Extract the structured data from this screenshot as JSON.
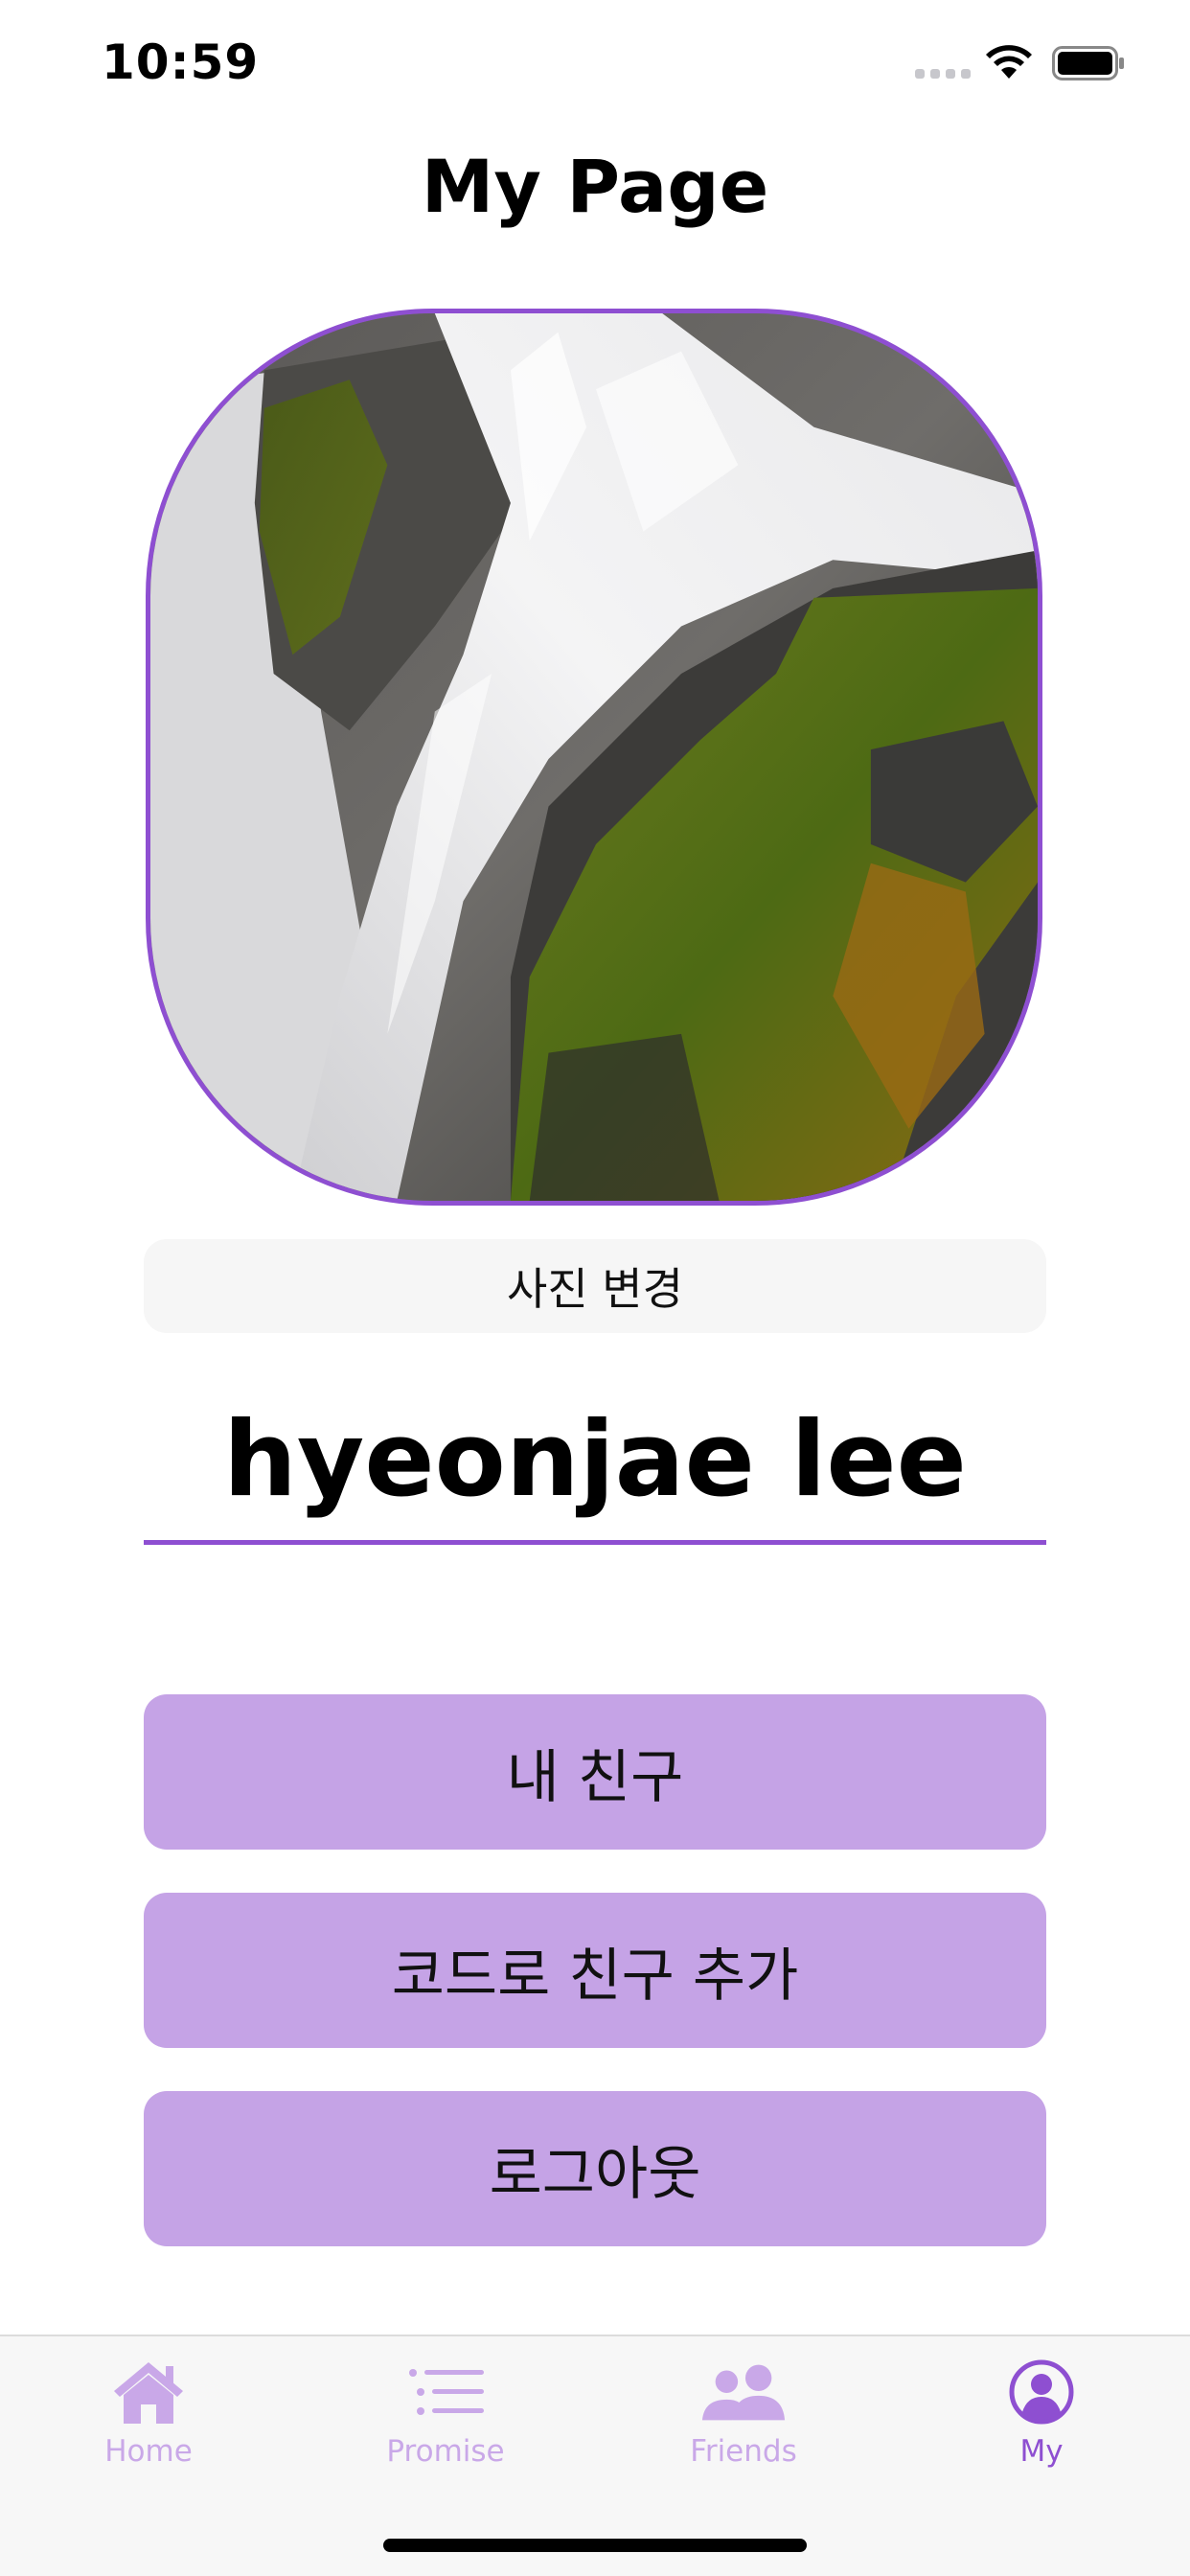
{
  "status_bar": {
    "time": "10:59"
  },
  "header": {
    "title": "My Page"
  },
  "profile": {
    "photo_alt": "waterfall-photo",
    "change_photo_label": "사진 변경",
    "name": "hyeonjae lee"
  },
  "actions": {
    "my_friends_label": "내 친구",
    "add_friend_by_code_label": "코드로 친구 추가",
    "logout_label": "로그아웃"
  },
  "tab_bar": {
    "items": [
      {
        "label": "Home",
        "icon": "house-icon",
        "active": false
      },
      {
        "label": "Promise",
        "icon": "list-icon",
        "active": false
      },
      {
        "label": "Friends",
        "icon": "people-icon",
        "active": false
      },
      {
        "label": "My",
        "icon": "person-circle-icon",
        "active": true
      }
    ]
  },
  "colors": {
    "accent": "#8e4fd1",
    "button_fill": "#c5a3e6",
    "tab_inactive": "#c9a8e8"
  }
}
